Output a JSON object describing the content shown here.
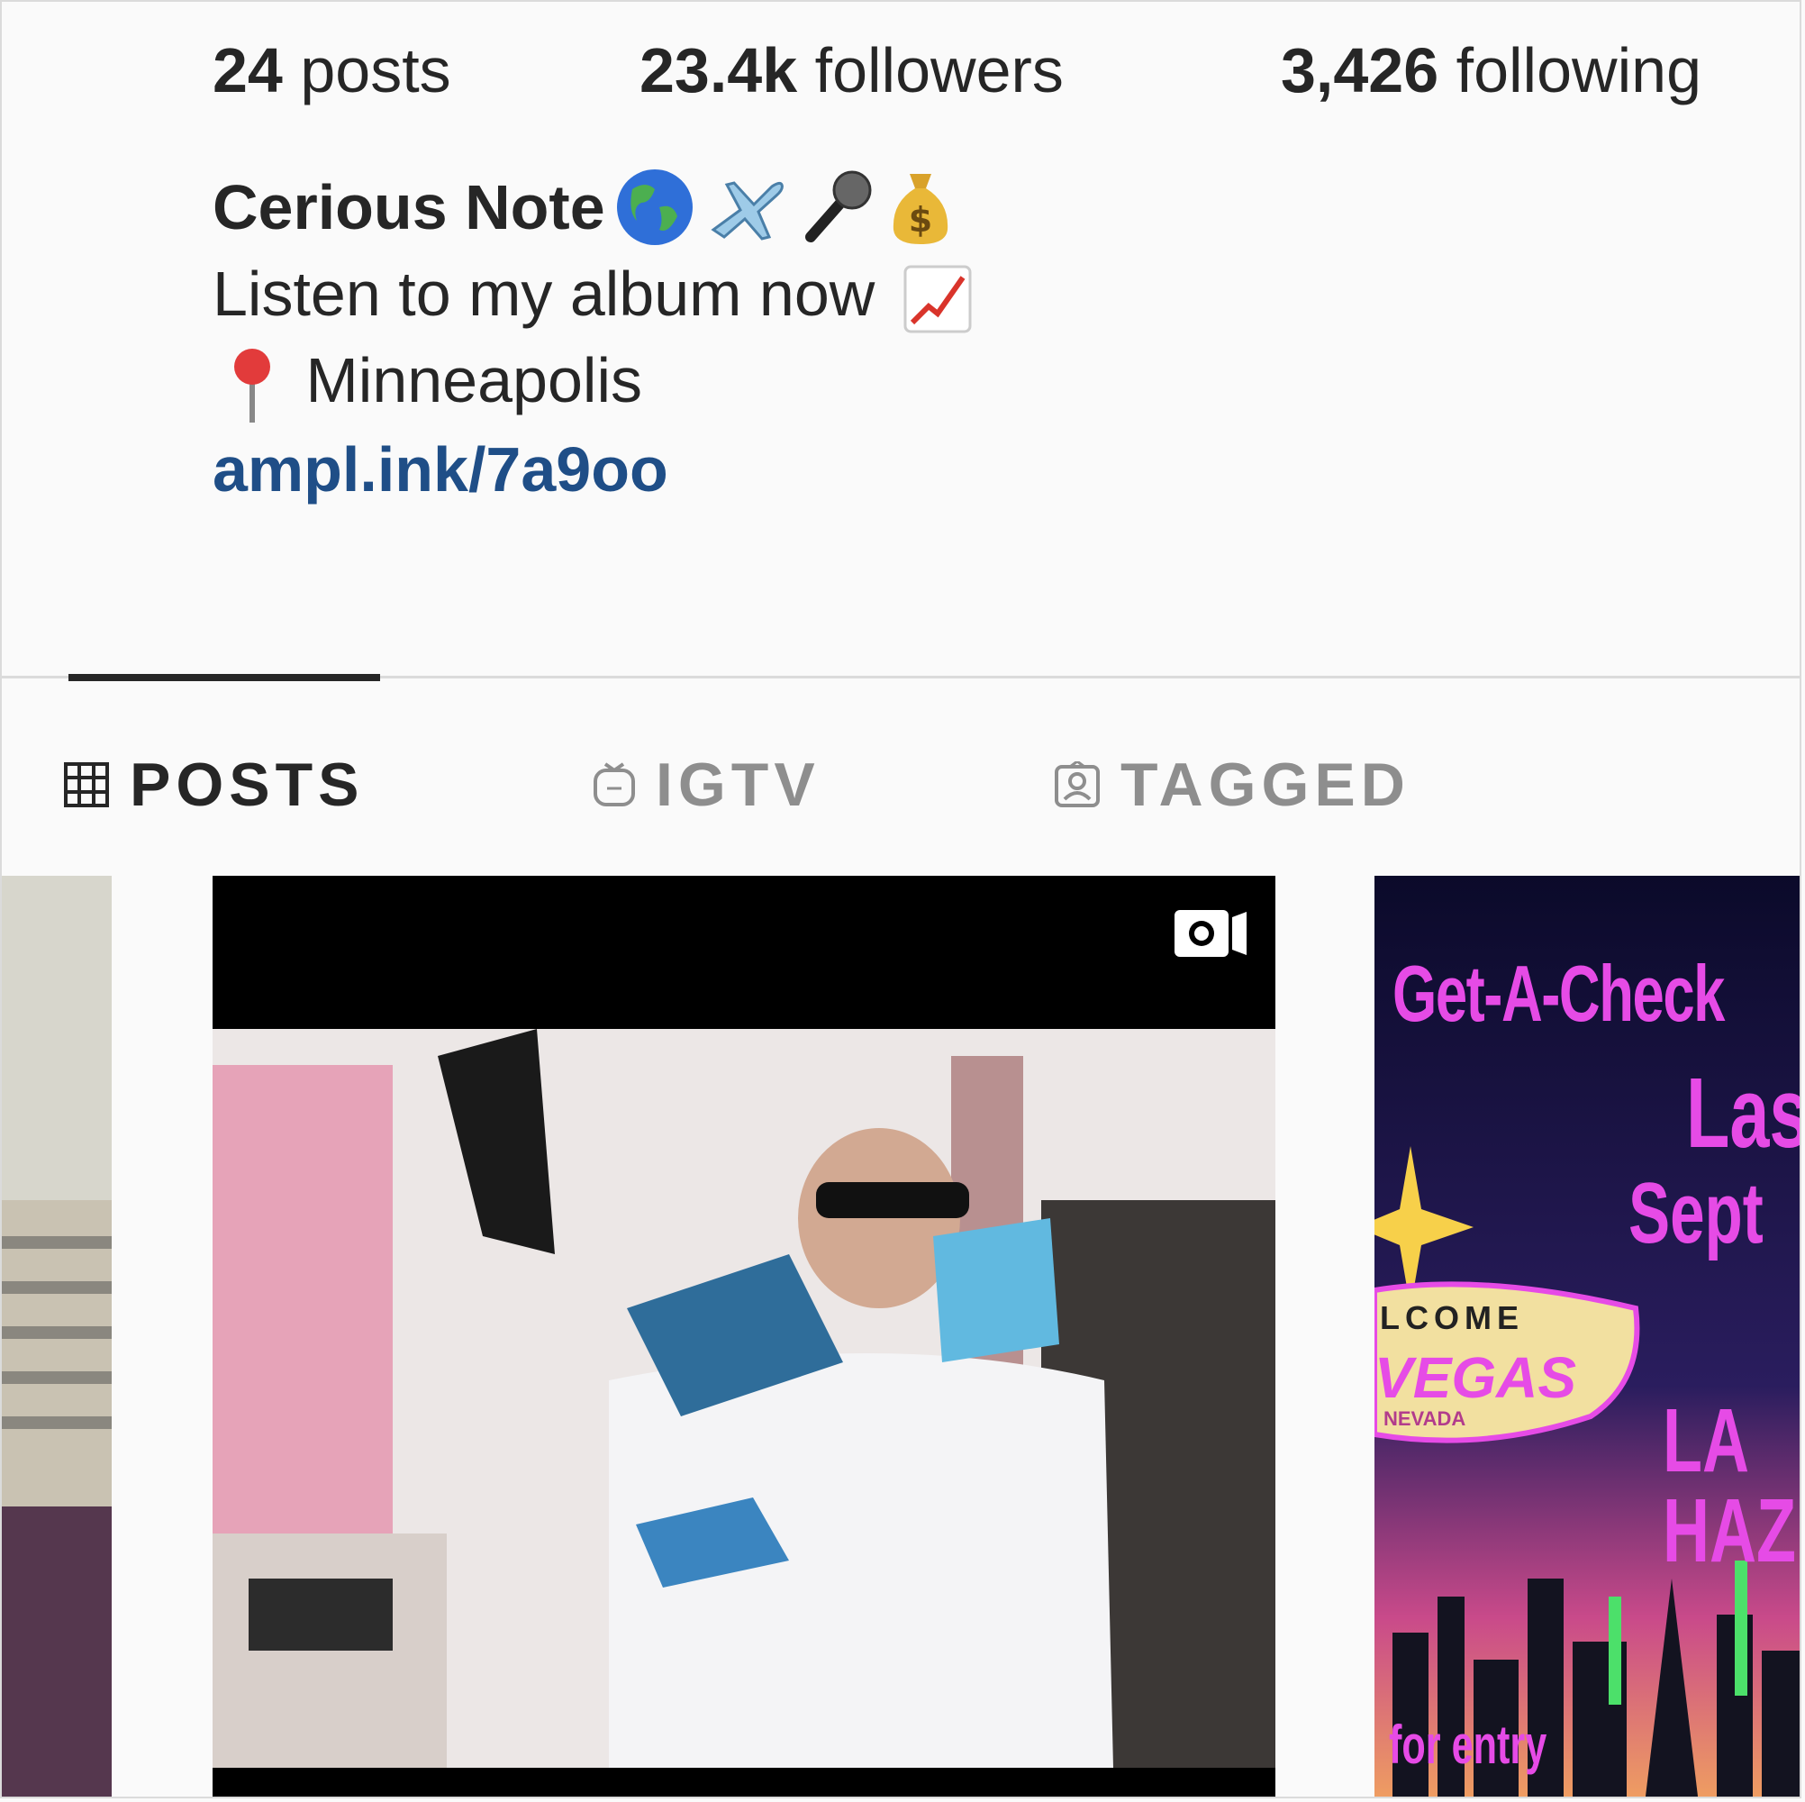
{
  "stats": {
    "posts_count": "24",
    "posts_label": "posts",
    "followers_count": "23.4k",
    "followers_label": "followers",
    "following_count": "3,426",
    "following_label": "following"
  },
  "bio": {
    "name": "Cerious Note",
    "name_emojis": [
      "globe-icon",
      "airplane-icon",
      "microphone-icon",
      "money-bag-icon"
    ],
    "line1": "Listen to my album now",
    "line1_emoji": "chart-increasing-icon",
    "location_emoji": "round-pushpin-icon",
    "location": "Minneapolis",
    "link": "ampl.ink/7a9oo"
  },
  "tabs": [
    {
      "label": "POSTS",
      "icon": "grid-icon",
      "active": true
    },
    {
      "label": "IGTV",
      "icon": "igtv-icon",
      "active": false
    },
    {
      "label": "TAGGED",
      "icon": "tagged-icon",
      "active": false
    }
  ],
  "grid": {
    "right_poster": {
      "line1": "Get-A-Check",
      "line2": "Las",
      "line3": "Sept",
      "sign_welcome": "LCOME",
      "sign_vegas": "VEGAS",
      "sign_nevada": "NEVADA",
      "line4": "LA",
      "line5": "HAZ",
      "footer": "for entry"
    }
  },
  "colors": {
    "text": "#262626",
    "muted": "#8e8e8e",
    "link": "#1f4e87",
    "poster_pink": "#e64be6"
  }
}
